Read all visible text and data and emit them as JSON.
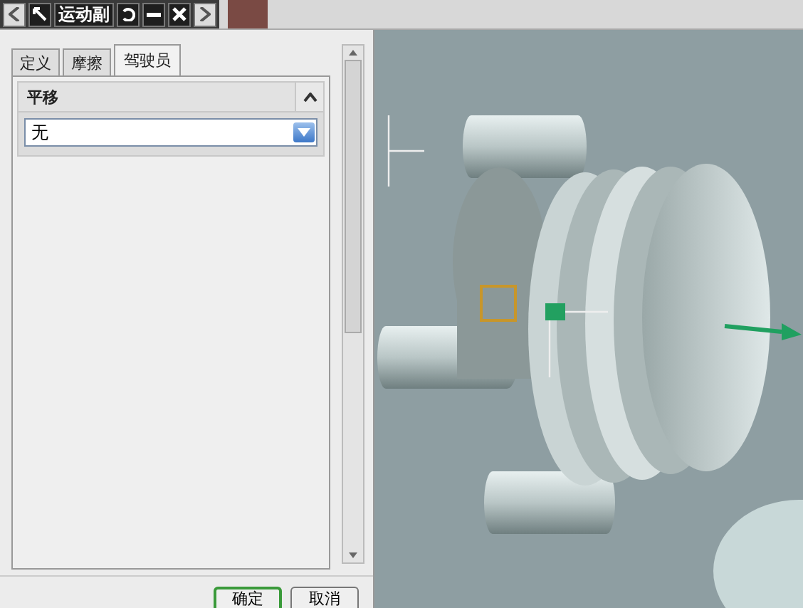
{
  "toolbar": {
    "title": "运动副"
  },
  "tabs": [
    {
      "label": "定义",
      "selected": false
    },
    {
      "label": "摩擦",
      "selected": false
    },
    {
      "label": "驾驶员",
      "selected": true
    }
  ],
  "section": {
    "title": "平移",
    "expanded": true,
    "dropdown": {
      "value": "无"
    }
  },
  "buttons": [
    {
      "label": "确定",
      "kind": "default"
    },
    {
      "label": "取消",
      "kind": "normal"
    }
  ]
}
